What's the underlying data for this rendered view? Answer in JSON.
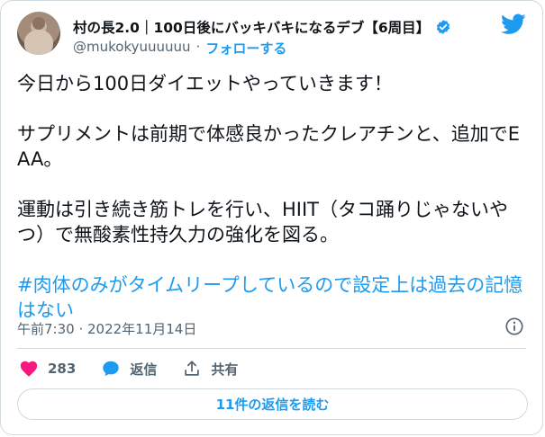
{
  "author": {
    "display_name": "村の長2.0｜100日後にバッキバキになるデブ【6周目】",
    "handle": "@mukokyuuuuuu",
    "separator": "·",
    "follow_label": "フォローする"
  },
  "tweet": {
    "paragraphs": [
      "今日から100日ダイエットやっていきます！",
      "サプリメントは前期で体感良かったクレアチンと、追加でEAA。",
      "運動は引き続き筋トレを行い、HIIT（タコ踊りじゃないやつ）で無酸素性持久力の強化を図る。"
    ],
    "hashtag_text": "#肉体のみがタイムリープしているので設定上は過去の記憶はない"
  },
  "meta": {
    "timestamp": "午前7:30 · 2022年11月14日"
  },
  "actions": {
    "like_count": "283",
    "reply_label": "返信",
    "share_label": "共有"
  },
  "replies_button_label": "11件の返信を読む",
  "colors": {
    "accent": "#1d9bf0",
    "like": "#f91880",
    "text": "#0f1419",
    "muted": "#536471",
    "border": "#cfd9de"
  },
  "icons": [
    "avatar",
    "verified-badge-icon",
    "twitter-bird-icon",
    "info-icon",
    "heart-icon",
    "reply-bubble-icon",
    "share-icon"
  ]
}
